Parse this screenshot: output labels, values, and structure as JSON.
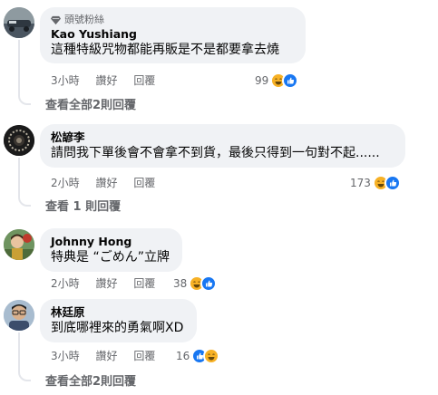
{
  "comments": [
    {
      "badge": "頭號粉絲",
      "author": "Kao Yushiang",
      "text": "這種特級咒物都能再販是不是都要拿去燒",
      "time": "3小時",
      "like_label": "讚好",
      "reply_label": "回覆",
      "reaction_count": "99",
      "view_replies": "查看全部2則回覆"
    },
    {
      "author": "松諺李",
      "text": "請問我下單後會不會拿不到貨，最後只得到一句對不起......",
      "time": "2小時",
      "like_label": "讚好",
      "reply_label": "回覆",
      "reaction_count": "173",
      "view_replies": "查看 1 則回覆"
    },
    {
      "author": "Johnny Hong",
      "text": "特典是 “ごめん”立牌",
      "time": "2小時",
      "like_label": "讚好",
      "reply_label": "回覆",
      "reaction_count": "38"
    },
    {
      "author": "林廷原",
      "text": "到底哪裡來的勇氣啊XD",
      "time": "3小時",
      "like_label": "讚好",
      "reply_label": "回覆",
      "reaction_count": "16",
      "view_replies": "查看全部2則回覆"
    }
  ],
  "colors": {
    "bubble": "#f0f2f5",
    "secondary_text": "#65676b",
    "like_blue": "#1877f2",
    "haha_yellow": "#f7b125"
  },
  "icons": [
    "diamond-badge-icon",
    "haha-reaction-icon",
    "like-reaction-icon"
  ]
}
